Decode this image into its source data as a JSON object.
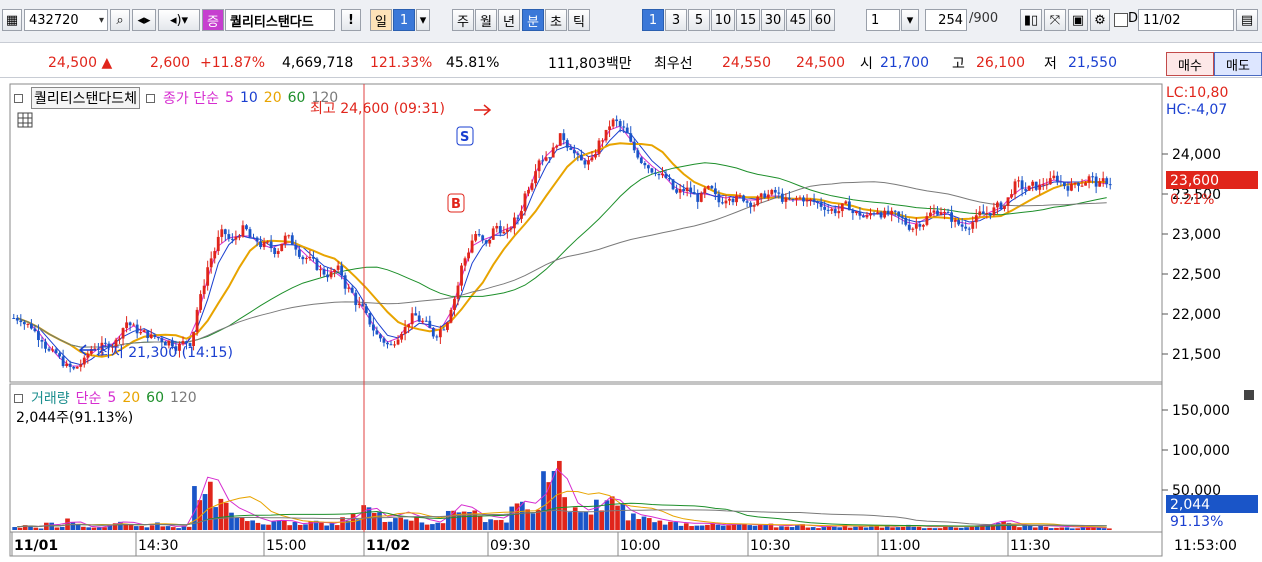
{
  "toolbar": {
    "code": "432720",
    "badge": "증",
    "name": "퀄리티스탠다드",
    "excl": "!",
    "period_day": "일",
    "period_day_n": "1",
    "period_week": "주",
    "period_month": "월",
    "period_year": "년",
    "period_min": "분",
    "period_sec": "초",
    "period_tick": "틱",
    "intervals": [
      "1",
      "3",
      "5",
      "10",
      "15",
      "30",
      "45",
      "60"
    ],
    "count": "1",
    "bars": "254",
    "bars_total": "/900",
    "checkbox_label": "D",
    "date": "11/02"
  },
  "quote": {
    "price": "24,500",
    "arrow": "▲",
    "change": "2,600",
    "change_pct": "+11.87%",
    "volume": "4,669,718",
    "vol_ratio": "121.33%",
    "turnover": "45.81%",
    "amount": "111,803백만",
    "best_label": "최우선",
    "ask": "24,550",
    "bid": "24,500",
    "open_label": "시",
    "open": "21,700",
    "high_label": "고",
    "high": "26,100",
    "low_label": "저",
    "low": "21,550",
    "buy": "매수",
    "sell": "매도"
  },
  "price_panel": {
    "name": "퀄리티스탠다드체",
    "ma_label": "종가 단순",
    "ma_periods": [
      "5",
      "10",
      "20",
      "60",
      "120"
    ],
    "lc": "LC:10,80",
    "hc": "HC:-4,07",
    "current_price": "23,600",
    "current_pct": "0.21%",
    "high_note": "최고 24,600 (09:31)",
    "low_note": "최저 21,300 (14:15)",
    "signal_s": "S",
    "signal_b": "B"
  },
  "volume_panel": {
    "title": "거래량",
    "ma_label": "단순",
    "ma_periods": [
      "5",
      "20",
      "60",
      "120"
    ],
    "current": "2,044주(91.13%)",
    "current_value": "2,044",
    "current_pct": "91.13%"
  },
  "time_axis": [
    "11/01",
    "14:30",
    "15:00",
    "11/02",
    "09:30",
    "10:00",
    "10:30",
    "11:00",
    "11:30",
    "11:53:00"
  ],
  "colors": {
    "up": "#e0251b",
    "down": "#1a55c8",
    "ma5": "#d62dd0",
    "ma10": "#1a3fd0",
    "ma20": "#e8a400",
    "ma60": "#1d8f2a",
    "ma120": "#7a7a7a"
  },
  "chart_data": [
    {
      "type": "candlestick",
      "ylim": [
        21200,
        24800
      ],
      "y_ticks": [
        "24,000",
        "23,500",
        "23,000",
        "22,500",
        "22,000",
        "21,500"
      ],
      "x_labels": [
        "11/01",
        "14:30",
        "15:00",
        "11/02",
        "09:30",
        "10:00",
        "10:30",
        "11:00",
        "11:30"
      ],
      "close_path": [
        21950,
        21850,
        21700,
        21500,
        21400,
        21300,
        21400,
        21600,
        21600,
        21650,
        21900,
        21800,
        21750,
        21700,
        21650,
        21600,
        21650,
        22200,
        22700,
        23000,
        22900,
        23050,
        22900,
        22850,
        22800,
        22950,
        22850,
        22700,
        22600,
        22500,
        22550,
        22300,
        22100,
        21900,
        21700,
        21600,
        21800,
        21950,
        21900,
        21750,
        21850,
        22200,
        22700,
        23000,
        22850,
        23100,
        23000,
        23200,
        23600,
        23950,
        24000,
        24200,
        24100,
        23900,
        23900,
        24200,
        24400,
        24300,
        24050,
        23900,
        23800,
        23700,
        23500,
        23550,
        23450,
        23550,
        23400,
        23500,
        23450,
        23400,
        23450,
        23500,
        23450,
        23400,
        23450,
        23400,
        23350,
        23300,
        23350,
        23250,
        23200,
        23300,
        23250,
        23200,
        23100,
        23150,
        23250,
        23300,
        23200,
        23100,
        23150,
        23250,
        23300,
        23350,
        23600,
        23550,
        23600,
        23650,
        23700,
        23600,
        23650,
        23700,
        23600,
        23650
      ]
    },
    {
      "type": "bar",
      "title": "거래량",
      "ylim": [
        0,
        180000
      ],
      "y_ticks": [
        "150,000",
        "100,000",
        "50,000"
      ],
      "values": [
        4000,
        6000,
        3000,
        9000,
        5000,
        14000,
        6000,
        3000,
        4000,
        8000,
        12000,
        7000,
        6000,
        9000,
        5000,
        4000,
        6000,
        52000,
        80000,
        45000,
        30000,
        25000,
        18000,
        12000,
        10000,
        14000,
        9000,
        7000,
        11000,
        8000,
        9000,
        14000,
        18000,
        32000,
        22000,
        12000,
        25000,
        20000,
        15000,
        11000,
        9000,
        28000,
        35000,
        22000,
        18000,
        16000,
        14000,
        30000,
        42000,
        25000,
        65000,
        88000,
        40000,
        28000,
        22000,
        35000,
        45000,
        30000,
        20000,
        18000,
        15000,
        12000,
        10000,
        9000,
        8000,
        9000,
        7000,
        6000,
        8000,
        7000,
        6000,
        7000,
        5000,
        6000,
        7000,
        5000,
        4000,
        5000,
        6000,
        4000,
        5000,
        6000,
        4000,
        5000,
        6000,
        5000,
        4000,
        4000,
        5000,
        4000,
        5000,
        6000,
        7000,
        14000,
        9000,
        6000,
        5000,
        6000,
        4000,
        5000,
        3000,
        4000,
        3000,
        2044
      ]
    }
  ]
}
